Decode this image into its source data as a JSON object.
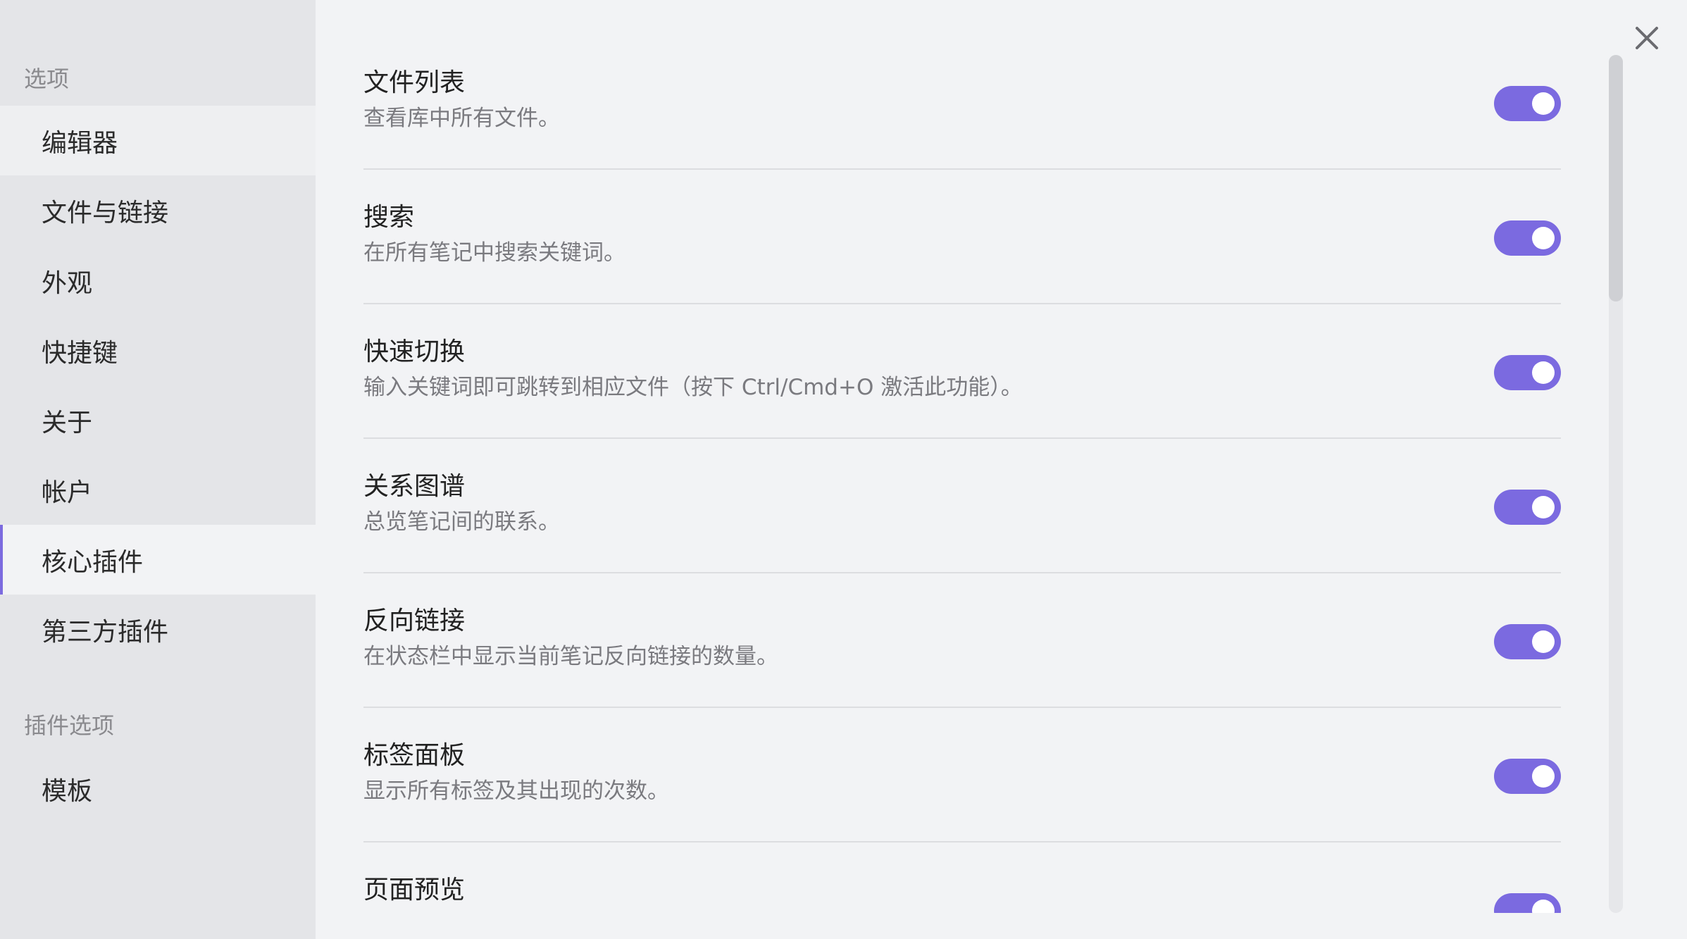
{
  "sidebar": {
    "options_title": "选项",
    "items": [
      {
        "label": "编辑器"
      },
      {
        "label": "文件与链接"
      },
      {
        "label": "外观"
      },
      {
        "label": "快捷键"
      },
      {
        "label": "关于"
      },
      {
        "label": "帐户"
      },
      {
        "label": "核心插件",
        "active": true
      },
      {
        "label": "第三方插件"
      }
    ],
    "plugin_options_title": "插件选项",
    "plugin_items": [
      {
        "label": "模板"
      }
    ]
  },
  "close": {
    "icon": "close-icon"
  },
  "settings": [
    {
      "name": "文件列表",
      "desc": "查看库中所有文件。",
      "enabled": true
    },
    {
      "name": "搜索",
      "desc": "在所有笔记中搜索关键词。",
      "enabled": true
    },
    {
      "name": "快速切换",
      "desc": "输入关键词即可跳转到相应文件（按下 Ctrl/Cmd+O 激活此功能）。",
      "enabled": true
    },
    {
      "name": "关系图谱",
      "desc": "总览笔记间的联系。",
      "enabled": true
    },
    {
      "name": "反向链接",
      "desc": "在状态栏中显示当前笔记反向链接的数量。",
      "enabled": true
    },
    {
      "name": "标签面板",
      "desc": "显示所有标签及其出现的次数。",
      "enabled": true
    },
    {
      "name": "页面预览",
      "desc": "",
      "enabled": true
    }
  ],
  "colors": {
    "accent": "#7b6ae0",
    "sidebar_bg": "#e4e5e8",
    "content_bg": "#f2f3f5"
  }
}
